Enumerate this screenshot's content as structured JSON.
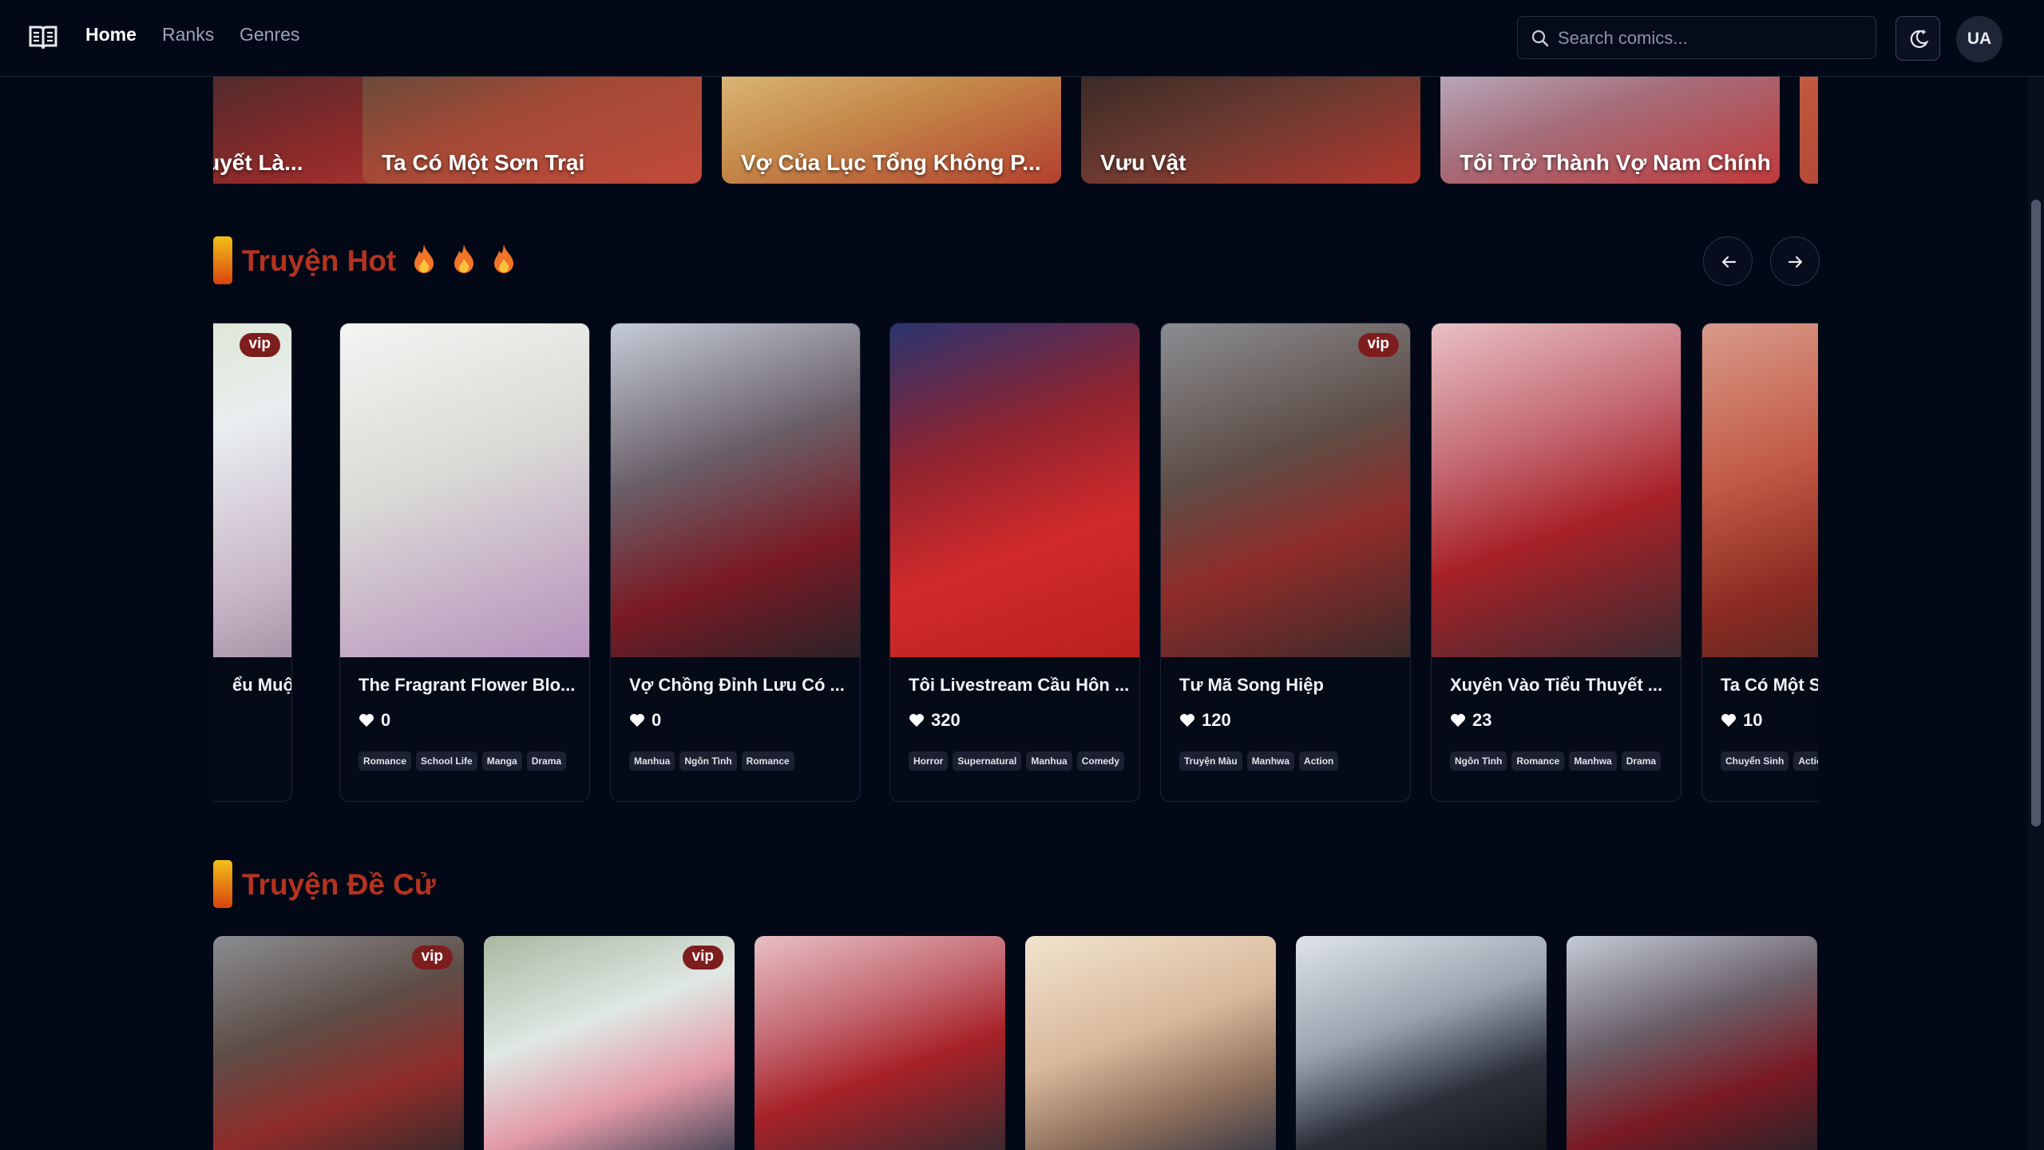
{
  "nav": {
    "links": [
      {
        "label": "Home",
        "active": true
      },
      {
        "label": "Ranks",
        "active": false
      },
      {
        "label": "Genres",
        "active": false
      }
    ],
    "search_placeholder": "Search comics...",
    "avatar": "UA",
    "theme_icon": "moon-sun-icon",
    "logo_icon": "open-book-icon"
  },
  "banner": {
    "items": [
      {
        "title": "huyết Là..."
      },
      {
        "title": "Ta Có Một Sơn Trại"
      },
      {
        "title": "Vợ Của Lục Tổng Không P..."
      },
      {
        "title": "Vưu Vật"
      },
      {
        "title": "Tôi Trở Thành Vợ Nam Chính"
      }
    ]
  },
  "hot": {
    "title": "Truyện Hot",
    "flame_icon": "fire-icon",
    "cards": [
      {
        "title": "ểu Muội ...",
        "likes": "",
        "tags": [],
        "vip": "vip"
      },
      {
        "title": "The Fragrant Flower Blo...",
        "likes": "0",
        "tags": [
          "Romance",
          "School Life",
          "Manga",
          "Drama"
        ],
        "vip": ""
      },
      {
        "title": "Vợ Chồng Đỉnh Lưu Có ...",
        "likes": "0",
        "tags": [
          "Manhua",
          "Ngôn Tình",
          "Romance"
        ],
        "vip": ""
      },
      {
        "title": "Tôi Livestream Cầu Hôn ...",
        "likes": "320",
        "tags": [
          "Horror",
          "Supernatural",
          "Manhua",
          "Comedy"
        ],
        "vip": ""
      },
      {
        "title": "Tư Mã Song Hiệp",
        "likes": "120",
        "tags": [
          "Truyện Màu",
          "Manhwa",
          "Action"
        ],
        "vip": "vip"
      },
      {
        "title": "Xuyên Vào Tiểu Thuyết ...",
        "likes": "23",
        "tags": [
          "Ngôn Tình",
          "Romance",
          "Manhwa",
          "Drama"
        ],
        "vip": ""
      },
      {
        "title": "Ta Có Một S",
        "likes": "10",
        "tags": [
          "Chuyển Sinh",
          "Actio"
        ],
        "vip": ""
      }
    ]
  },
  "recommend": {
    "title": "Truyện Đề Cử",
    "cards": [
      {
        "vip": "vip"
      },
      {
        "vip": "vip"
      },
      {
        "vip": ""
      },
      {
        "vip": ""
      },
      {
        "vip": ""
      },
      {
        "vip": ""
      }
    ]
  },
  "colors": {
    "background": "#030816",
    "accent_title": "#b5331f",
    "vip_badge": "#7e1d1d"
  }
}
